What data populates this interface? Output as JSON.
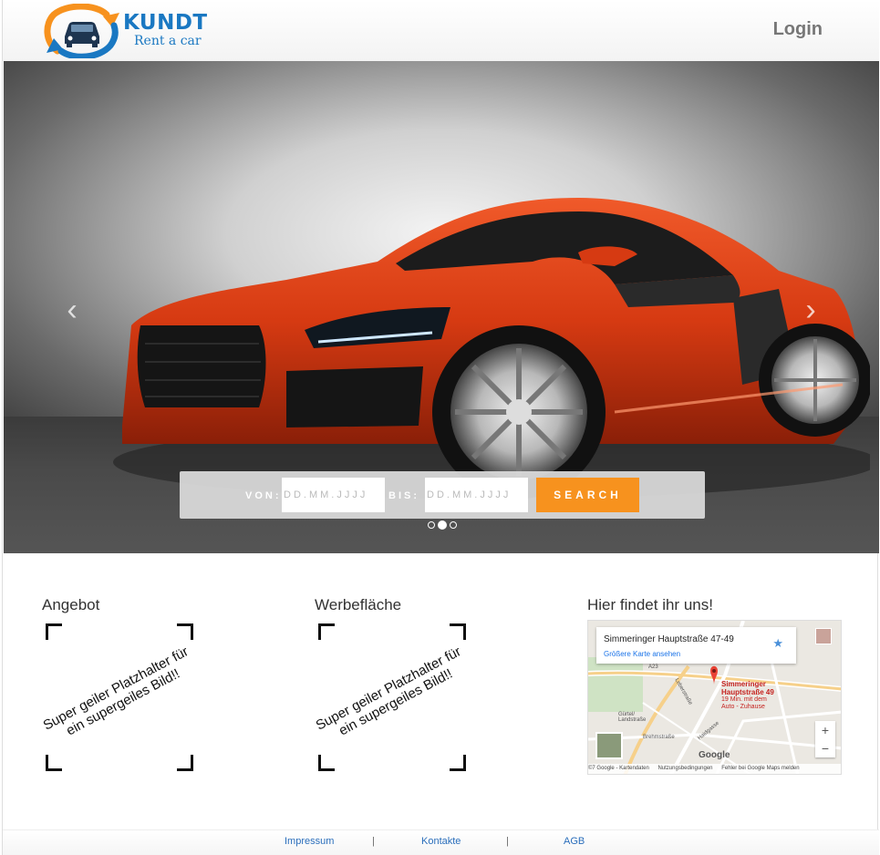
{
  "header": {
    "logo_title": "KUNDT",
    "logo_subtitle": "Rent a car",
    "login_label": "Login"
  },
  "hero": {
    "prev_arrow": "‹",
    "next_arrow": "›",
    "search": {
      "from_label": "VON:",
      "from_placeholder": "DD.MM.JJJJ",
      "to_label": "BIS:",
      "to_placeholder": "DD.MM.JJJJ",
      "button_label": "SEARCH"
    },
    "slides_count": 3,
    "active_slide": 2
  },
  "columns": {
    "angebot": {
      "title": "Angebot",
      "placeholder_text": "Super geiler Platzhalter für ein supergeiles Bild!!"
    },
    "werbeflaeche": {
      "title": "Werbefläche",
      "placeholder_text": "Super geiler Platzhalter für ein supergeiles Bild!!"
    },
    "map": {
      "title": "Hier findet ihr uns!",
      "address": "Simmeringer Hauptstraße 47-49",
      "larger_map_link": "Größere Karte ansehen",
      "pin_label_line1": "Simmeringer",
      "pin_label_line2": "Hauptstraße 49",
      "pin_sub_line1": "19 Min. mit dem",
      "pin_sub_line2": "Auto - Zuhause",
      "road_a23": "A23",
      "road_guertel": "Gürtel/ Landstraße",
      "road_brehm": "Brehmstraße",
      "road_leber": "Leberstraße",
      "road_haid": "Haidgasse",
      "google_label": "Google",
      "zoom_in": "+",
      "zoom_out": "−",
      "footer_data": "©7 Google - Kartendaten",
      "footer_terms": "Nutzungsbedingungen",
      "footer_report": "Fehler bei Google Maps melden"
    }
  },
  "footer": {
    "impressum": "Impressum",
    "kontakte": "Kontakte",
    "agb": "AGB",
    "separator": "|"
  },
  "colors": {
    "brand_blue": "#1a78c2",
    "brand_orange": "#f7921e",
    "car_red": "#d63a12"
  }
}
